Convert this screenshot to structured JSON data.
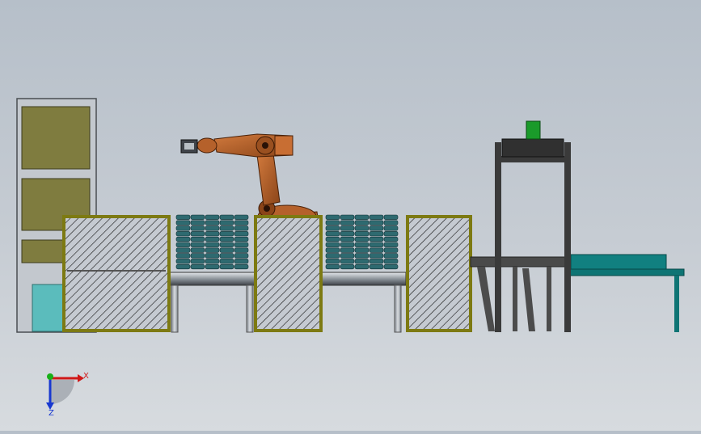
{
  "view": {
    "background_top": "#b6bfc9",
    "background_bottom": "#d7dbdf"
  },
  "colors": {
    "guard_frame": "#7d7a12",
    "guard_fill": "#b8bec6",
    "stack_panel": "#7f7c3f",
    "tray_stack": "#2e6a70",
    "robot": "#b5612b",
    "conveyor_teal": "#118080",
    "frame_dark": "#3a3a3a",
    "product_green": "#1a9a2a"
  },
  "triad": {
    "x_label": "X",
    "z_label": "Z",
    "x_color": "#d01818",
    "y_color": "#18b018",
    "z_color": "#1838d0"
  }
}
